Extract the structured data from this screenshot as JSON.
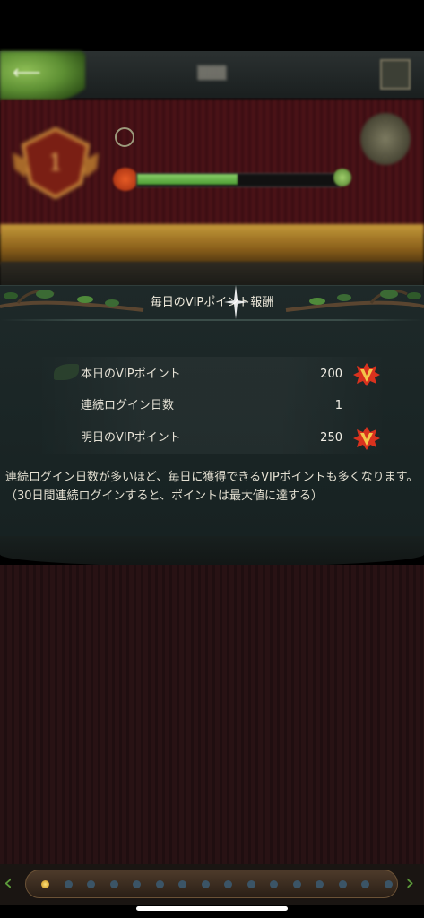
{
  "popup": {
    "title": "毎日のVIPポイント報酬",
    "rows": [
      {
        "label": "本日のVIPポイント",
        "value": "200",
        "icon": "vip-v-icon"
      },
      {
        "label": "連続ログイン日数",
        "value": "1"
      },
      {
        "label": "明日のVIPポイント",
        "value": "250",
        "icon": "vip-v-icon"
      }
    ],
    "note": "連続ログイン日数が多いほど、毎日に獲得できるVIPポイントも多くなります。（30日間連続ログインすると、ポイントは最大値に達する）"
  },
  "vip_header": {
    "progress_fraction": 0.5,
    "rank_numeral": "1"
  },
  "pagination": {
    "page_count": 16,
    "active_index": 0
  },
  "colors": {
    "popup_bg": "#1e2929",
    "accent_gold": "#c59a3a",
    "vip_red": "#d8321e",
    "leaf_green": "#5d8f33"
  },
  "icons": {
    "back": "back-arrow-icon",
    "gift": "gift-box-icon",
    "shop": "vip-shop-icon",
    "vip": "vip-v-icon",
    "emblem": "vip-rank-emblem-icon"
  }
}
